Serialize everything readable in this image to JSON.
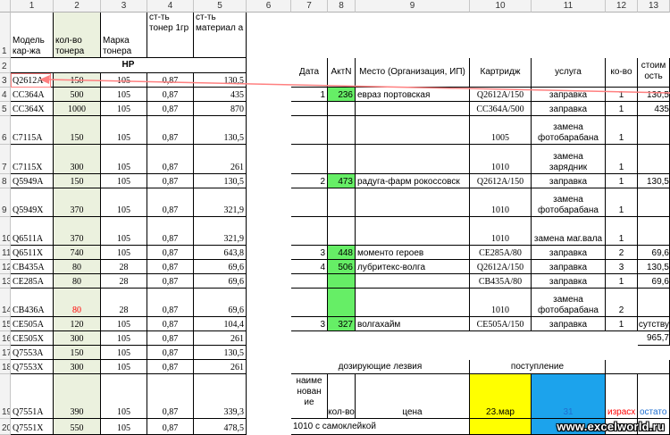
{
  "col_headers": [
    "1",
    "2",
    "3",
    "4",
    "5",
    "6",
    "7",
    "8",
    "9",
    "10",
    "11",
    "12",
    "13"
  ],
  "row_headers": [
    "1",
    "2",
    "3",
    "4",
    "5",
    "6",
    "7",
    "8",
    "9",
    "10",
    "11",
    "12",
    "13",
    "14",
    "15",
    "16",
    "17",
    "18",
    "19",
    "20"
  ],
  "left_header": {
    "model": "Модель кар-жа",
    "qty": "кол-во тонера",
    "brand": "Марка тонера",
    "price_gram": "ст-ть тонер 1гр",
    "cost": "ст-ть материал а"
  },
  "hp_label": "HP",
  "left_rows": [
    {
      "row": "3",
      "model": "Q2612A",
      "qty": "150",
      "brand": "105",
      "price": "0,87",
      "cost": "130,5"
    },
    {
      "row": "4",
      "model": "CC364A",
      "qty": "500",
      "brand": "105",
      "price": "0,87",
      "cost": "435"
    },
    {
      "row": "5",
      "model": "CC364X",
      "qty": "1000",
      "brand": "105",
      "price": "0,87",
      "cost": "870"
    },
    {
      "row": "6",
      "model": "C7115A",
      "qty": "150",
      "brand": "105",
      "price": "0,87",
      "cost": "130,5"
    },
    {
      "row": "7",
      "model": "C7115X",
      "qty": "300",
      "brand": "105",
      "price": "0,87",
      "cost": "261"
    },
    {
      "row": "8",
      "model": "Q5949A",
      "qty": "150",
      "brand": "105",
      "price": "0,87",
      "cost": "130,5"
    },
    {
      "row": "9",
      "model": "Q5949X",
      "qty": "370",
      "brand": "105",
      "price": "0,87",
      "cost": "321,9"
    },
    {
      "row": "10",
      "model": "Q6511A",
      "qty": "370",
      "brand": "105",
      "price": "0,87",
      "cost": "321,9"
    },
    {
      "row": "11",
      "model": "Q6511X",
      "qty": "740",
      "brand": "105",
      "price": "0,87",
      "cost": "643,8"
    },
    {
      "row": "12",
      "model": "CB435A",
      "qty": "80",
      "brand": "28",
      "price": "0,87",
      "cost": "69,6"
    },
    {
      "row": "13",
      "model": "CE285A",
      "qty": "80",
      "brand": "28",
      "price": "0,87",
      "cost": "69,6"
    },
    {
      "row": "14",
      "model": "CB436A",
      "qty": "80",
      "brand": "28",
      "price": "0,87",
      "cost": "69,6"
    },
    {
      "row": "15",
      "model": "CE505A",
      "qty": "120",
      "brand": "105",
      "price": "0,87",
      "cost": "104,4"
    },
    {
      "row": "16",
      "model": "CE505X",
      "qty": "300",
      "brand": "105",
      "price": "0,87",
      "cost": "261"
    },
    {
      "row": "17",
      "model": "Q7553A",
      "qty": "150",
      "brand": "105",
      "price": "0,87",
      "cost": "130,5"
    },
    {
      "row": "18",
      "model": "Q7553X",
      "qty": "300",
      "brand": "105",
      "price": "0,87",
      "cost": "261"
    },
    {
      "row": "19",
      "model": "Q7551A",
      "qty": "390",
      "brand": "105",
      "price": "0,87",
      "cost": "339,3"
    },
    {
      "row": "20",
      "model": "Q7551X",
      "qty": "550",
      "brand": "105",
      "price": "0,87",
      "cost": "478,5"
    }
  ],
  "right_header": {
    "date": "Дата",
    "act": "АктN",
    "place": "Место (Организация, ИП)",
    "cart": "Картридж",
    "service": "услуга",
    "count": "ко-во",
    "cost": "стоим ость"
  },
  "right_rows": [
    {
      "date": "1",
      "act": "236",
      "place": "евраз портовская",
      "cart": "Q2612A/150",
      "service": "заправка",
      "count": "1",
      "cost": "130,5"
    },
    {
      "date": "",
      "act": "",
      "place": "",
      "cart": "CC364A/500",
      "service": "заправка",
      "count": "1",
      "cost": "435"
    },
    {
      "date": "",
      "act": "",
      "place": "",
      "cart": "1005",
      "service": "замена фотобарабана",
      "count": "1",
      "cost": ""
    },
    {
      "date": "",
      "act": "",
      "place": "",
      "cart": "1010",
      "service": "замена зарядник",
      "count": "1",
      "cost": ""
    },
    {
      "date": "2",
      "act": "473",
      "place": "радуга-фарм рокоссовск",
      "cart": "Q2612A/150",
      "service": "заправка",
      "count": "1",
      "cost": "130,5"
    },
    {
      "date": "",
      "act": "",
      "place": "",
      "cart": "1010",
      "service": "замена фотобарабана",
      "count": "1",
      "cost": ""
    },
    {
      "date": "",
      "act": "",
      "place": "",
      "cart": "1010",
      "service": "замена маг.вала",
      "count": "1",
      "cost": ""
    },
    {
      "date": "3",
      "act": "448",
      "place": "моменто героев",
      "cart": "CE285A/80",
      "service": "заправка",
      "count": "2",
      "cost": "69,6"
    },
    {
      "date": "4",
      "act": "506",
      "place": "лубритекс-волга",
      "cart": "Q2612A/150",
      "service": "заправка",
      "count": "3",
      "cost": "130,5"
    },
    {
      "date": "",
      "act": "",
      "place": "",
      "cart": "CB435A/80",
      "service": "заправка",
      "count": "1",
      "cost": "69,6"
    },
    {
      "date": "",
      "act": "",
      "place": "",
      "cart": "1010",
      "service": "замена фотобарабана",
      "count": "2",
      "cost": ""
    },
    {
      "date": "3",
      "act": "327",
      "place": "волгахайм",
      "cart": "CE505A/150",
      "service": "заправка",
      "count": "1",
      "cost": "сутству"
    }
  ],
  "total": "965,7",
  "dosing": {
    "title": "дозирующие лезвия",
    "arrival": "поступление",
    "name_header": "наиме нован ие",
    "qty_header": "кол-во",
    "price_header": "цена",
    "date1": "23.мар",
    "date2": "31",
    "spent": "израсх",
    "remain": "остато",
    "first_item": "1010 с самоклейкой"
  },
  "watermark": "www.excelworld.ru",
  "colors": {
    "act_green": "#66ee66",
    "date_yellow": "#ffff00",
    "date_blue": "#1ca3ec",
    "arrow_red": "#ff8080",
    "qty_bg": "#ebf1de",
    "red_text": "#ff0000",
    "blue_text": "#1f6fd1"
  }
}
